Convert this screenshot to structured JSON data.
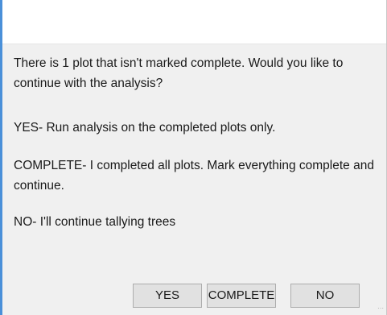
{
  "dialog": {
    "title": "",
    "message_line": "There is 1 plot that isn't marked complete. Would you like to continue with the analysis?",
    "yes_description": "YES- Run analysis on the completed plots only.",
    "complete_description": "COMPLETE- I completed all plots. Mark everything complete and continue.",
    "no_description": "NO- I'll continue tallying trees"
  },
  "buttons": {
    "yes_label": "YES",
    "complete_label": "COMPLETE",
    "no_label": "NO"
  },
  "colors": {
    "content_background": "#f0f0f0",
    "title_background": "#ffffff",
    "frame_accent": "#4a90d9",
    "button_background": "#e1e1e1",
    "button_border": "#adadad"
  },
  "icons": {
    "resize_grip": "size-grip-icon"
  }
}
